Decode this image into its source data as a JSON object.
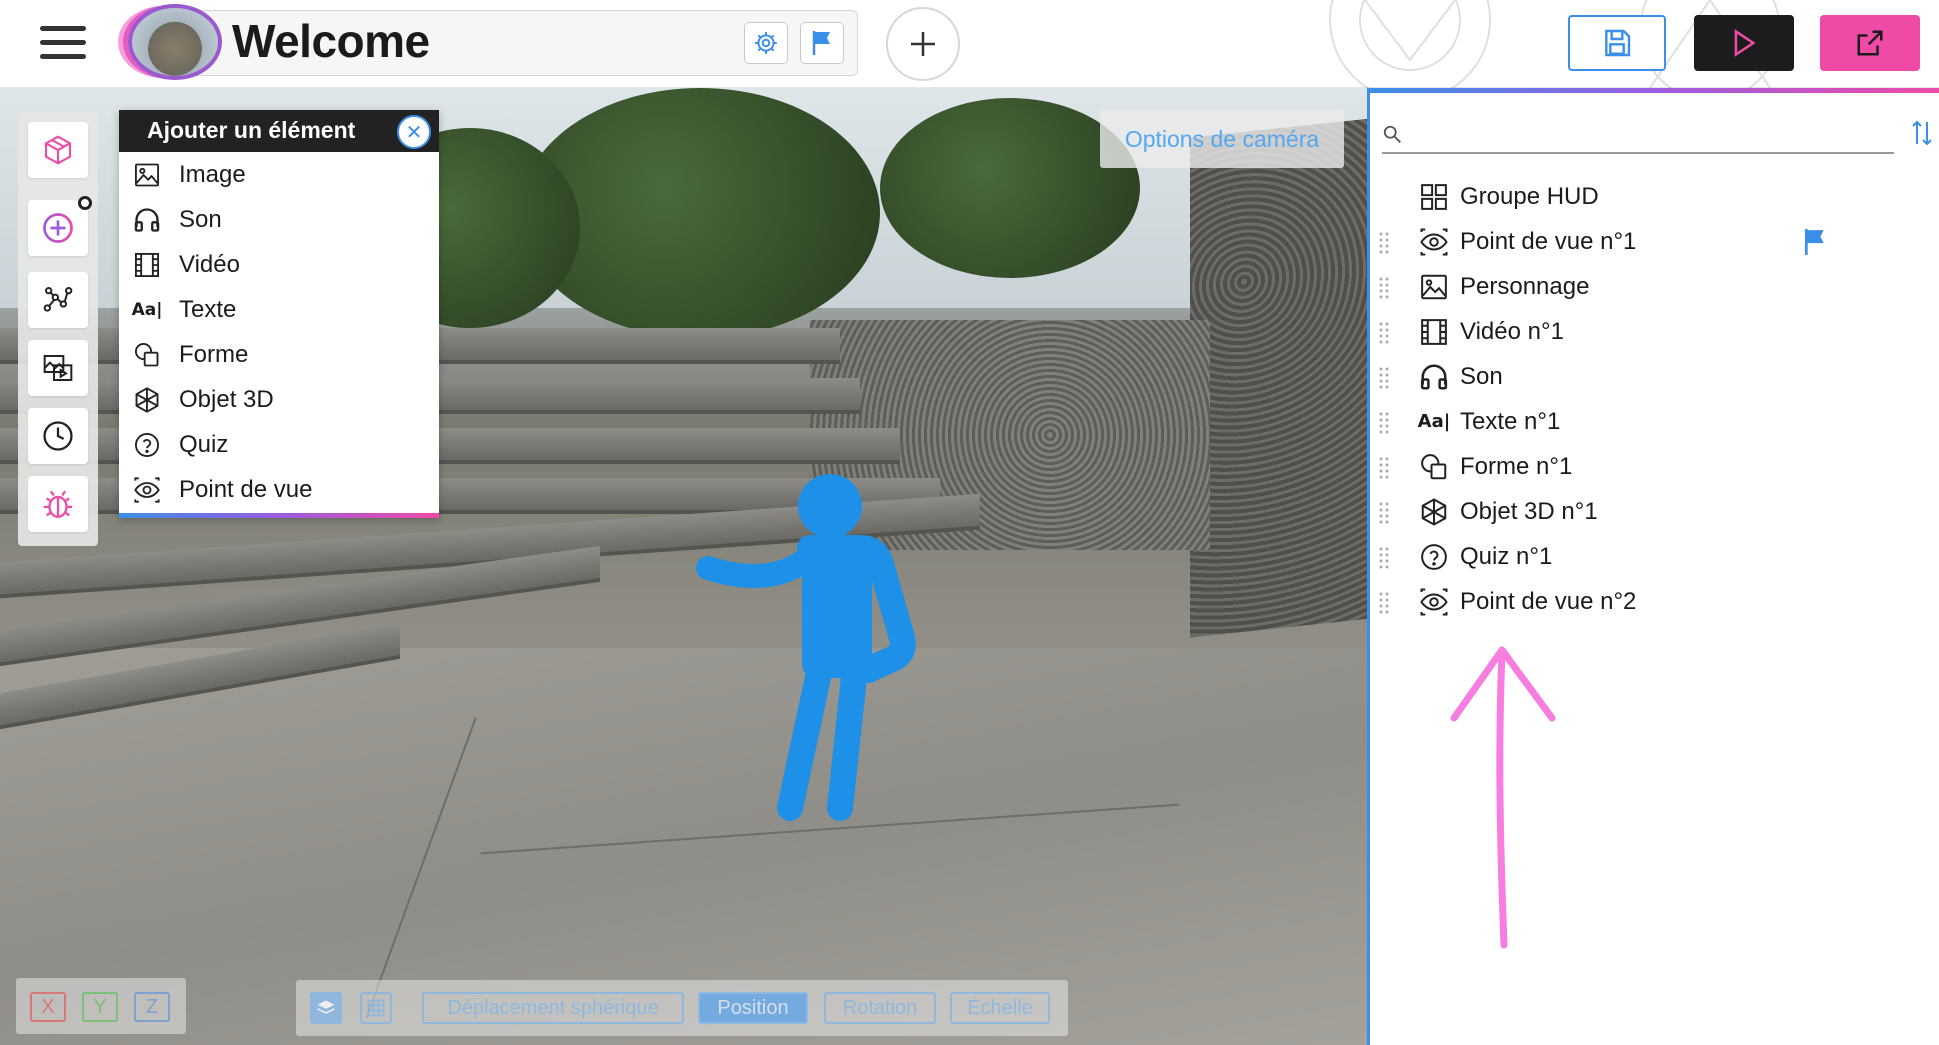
{
  "header": {
    "title": "Welcome",
    "accent_pink": "#ef4aa6",
    "accent_blue": "#3b8fe8"
  },
  "add_menu": {
    "title": "Ajouter un élément",
    "items": [
      {
        "label": "Image",
        "icon": "image-icon"
      },
      {
        "label": "Son",
        "icon": "headphones-icon"
      },
      {
        "label": "Vidéo",
        "icon": "film-icon"
      },
      {
        "label": "Texte",
        "icon": "text-icon"
      },
      {
        "label": "Forme",
        "icon": "shape-icon"
      },
      {
        "label": "Objet 3D",
        "icon": "cube-icon"
      },
      {
        "label": "Quiz",
        "icon": "question-icon"
      },
      {
        "label": "Point de vue",
        "icon": "eye-icon"
      }
    ]
  },
  "camera": {
    "label": "Options de caméra"
  },
  "axes": {
    "x": "X",
    "y": "Y",
    "z": "Z"
  },
  "modes": {
    "spherical": "Déplacement sphérique",
    "position": "Position",
    "rotation": "Rotation",
    "scale": "Échelle"
  },
  "panel": {
    "search_placeholder": "",
    "items": [
      {
        "label": "Groupe HUD",
        "icon": "grid-icon"
      },
      {
        "label": "Point de vue n°1",
        "icon": "eye-icon",
        "flag": true
      },
      {
        "label": "Personnage",
        "icon": "image-icon"
      },
      {
        "label": "Vidéo n°1",
        "icon": "film-icon"
      },
      {
        "label": "Son",
        "icon": "headphones-icon"
      },
      {
        "label": "Texte n°1",
        "icon": "text-icon"
      },
      {
        "label": "Forme n°1",
        "icon": "shape-icon"
      },
      {
        "label": "Objet 3D n°1",
        "icon": "cube-icon"
      },
      {
        "label": "Quiz n°1",
        "icon": "question-icon"
      },
      {
        "label": "Point de vue n°2",
        "icon": "eye-icon"
      }
    ]
  }
}
